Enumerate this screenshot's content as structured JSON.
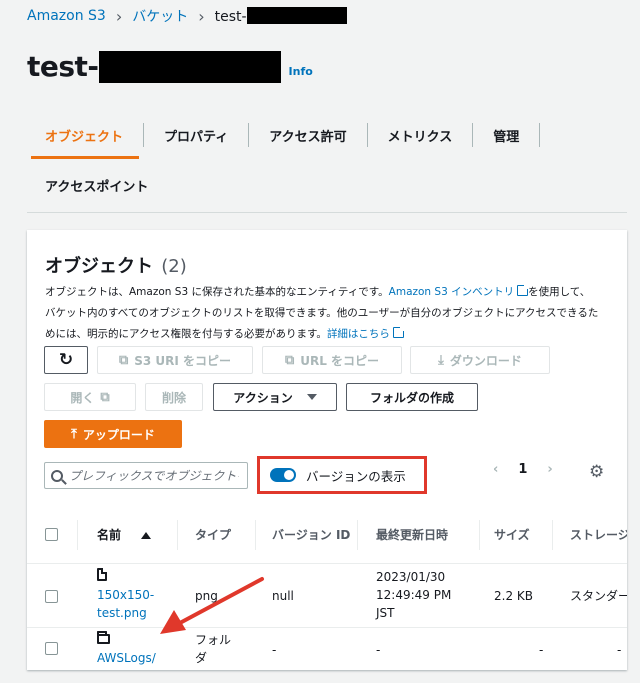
{
  "breadcrumb": {
    "root": "Amazon S3",
    "buckets": "バケット",
    "current": "test-"
  },
  "header": {
    "title": "test-",
    "info": "Info"
  },
  "tabs": [
    {
      "label": "オブジェクト"
    },
    {
      "label": "プロパティ"
    },
    {
      "label": "アクセス許可"
    },
    {
      "label": "メトリクス"
    },
    {
      "label": "管理"
    },
    {
      "label": "アクセスポイント"
    }
  ],
  "objects": {
    "title": "オブジェクト",
    "count": "(2)",
    "desc_part1": "オブジェクトは、Amazon S3 に保存された基本的なエンティティです。",
    "inventory_link": "Amazon S3 インベントリ",
    "desc_part2": "を使用して、バケット内のすべてのオブジェクトのリストを取得できます。他のユーザーが自分のオブジェクトにアクセスできるためには、明示的にアクセス権限を付与する必要があります。",
    "details_link": "詳細はこちら"
  },
  "toolbar": {
    "copy_s3_uri": "S3 URI をコピー",
    "copy_url": "URL をコピー",
    "download": "ダウンロード",
    "open": "開く",
    "delete": "削除",
    "actions": "アクション",
    "create_folder": "フォルダの作成",
    "upload": "アップロード"
  },
  "search": {
    "placeholder": "プレフィックスでオブジェクトを検索"
  },
  "versions": {
    "label": "バージョンの表示",
    "enabled": true
  },
  "pagination": {
    "page": "1"
  },
  "table": {
    "columns": [
      "名前",
      "タイプ",
      "バージョン ID",
      "最終更新日時",
      "サイズ",
      "ストレージクラス"
    ],
    "rows": [
      {
        "name_line1": "150x150-",
        "name_line2": "test.png",
        "type": "png",
        "version_id": "null",
        "modified_line1": "2023/01/30",
        "modified_line2": "12:49:49 PM",
        "modified_line3": "JST",
        "size": "2.2 KB",
        "storage": "スタンダード"
      },
      {
        "name": "AWSLogs/",
        "type_line1": "フォル",
        "type_line2": "ダ",
        "version_id": "-",
        "modified": "-",
        "size": "-",
        "storage": "-"
      }
    ]
  },
  "colors": {
    "accent": "#ec7211",
    "link": "#0073bb",
    "highlight": "#e0382b"
  }
}
